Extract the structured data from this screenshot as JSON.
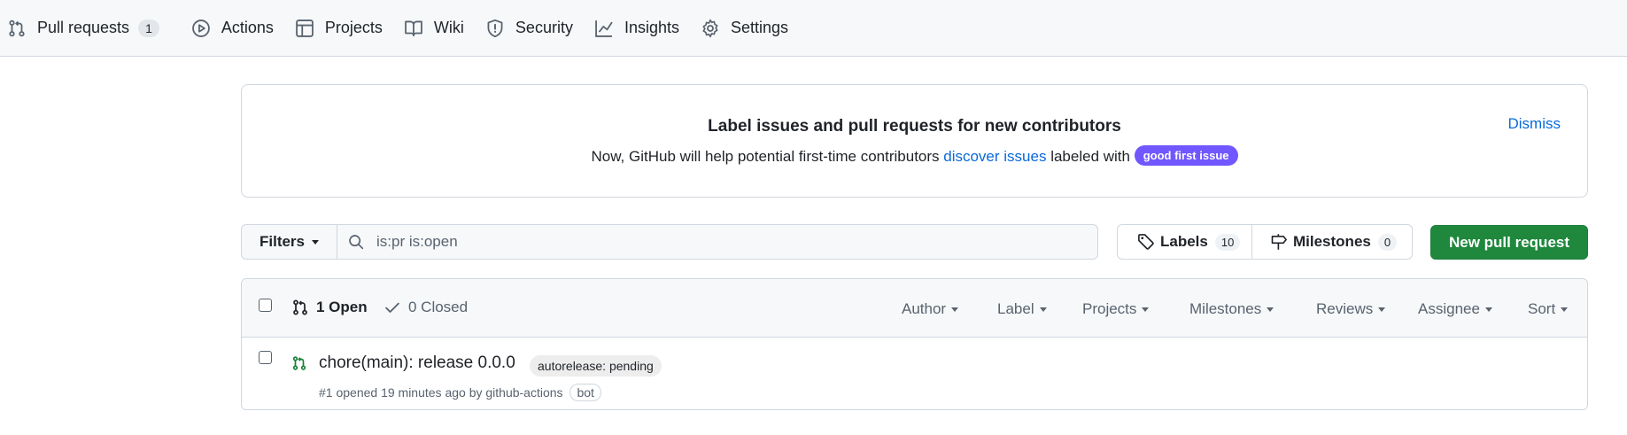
{
  "nav": {
    "pull_requests": "Pull requests",
    "pull_requests_count": "1",
    "actions": "Actions",
    "projects": "Projects",
    "wiki": "Wiki",
    "security": "Security",
    "insights": "Insights",
    "settings": "Settings"
  },
  "banner": {
    "title": "Label issues and pull requests for new contributors",
    "text_before": "Now, GitHub will help potential first-time contributors ",
    "link": "discover issues",
    "text_after": " labeled with ",
    "label": "good first issue",
    "dismiss": "Dismiss"
  },
  "toolbar": {
    "filters": "Filters",
    "search_value": "is:pr is:open",
    "labels": "Labels",
    "labels_count": "10",
    "milestones": "Milestones",
    "milestones_count": "0",
    "new_pr": "New pull request"
  },
  "list": {
    "open": "1 Open",
    "closed": "0 Closed",
    "filters": {
      "author": "Author",
      "label": "Label",
      "projects": "Projects",
      "milestones": "Milestones",
      "reviews": "Reviews",
      "assignee": "Assignee",
      "sort": "Sort"
    },
    "items": [
      {
        "title": "chore(main): release 0.0.0",
        "label": "autorelease: pending",
        "meta_prefix": "#1 opened 19 minutes ago by ",
        "user": "github-actions",
        "badge": "bot"
      }
    ]
  },
  "colors": {
    "accent": "#0969da",
    "green": "#1f883d",
    "good_first_issue": "#7057ff",
    "open_icon": "#1a7f37"
  }
}
